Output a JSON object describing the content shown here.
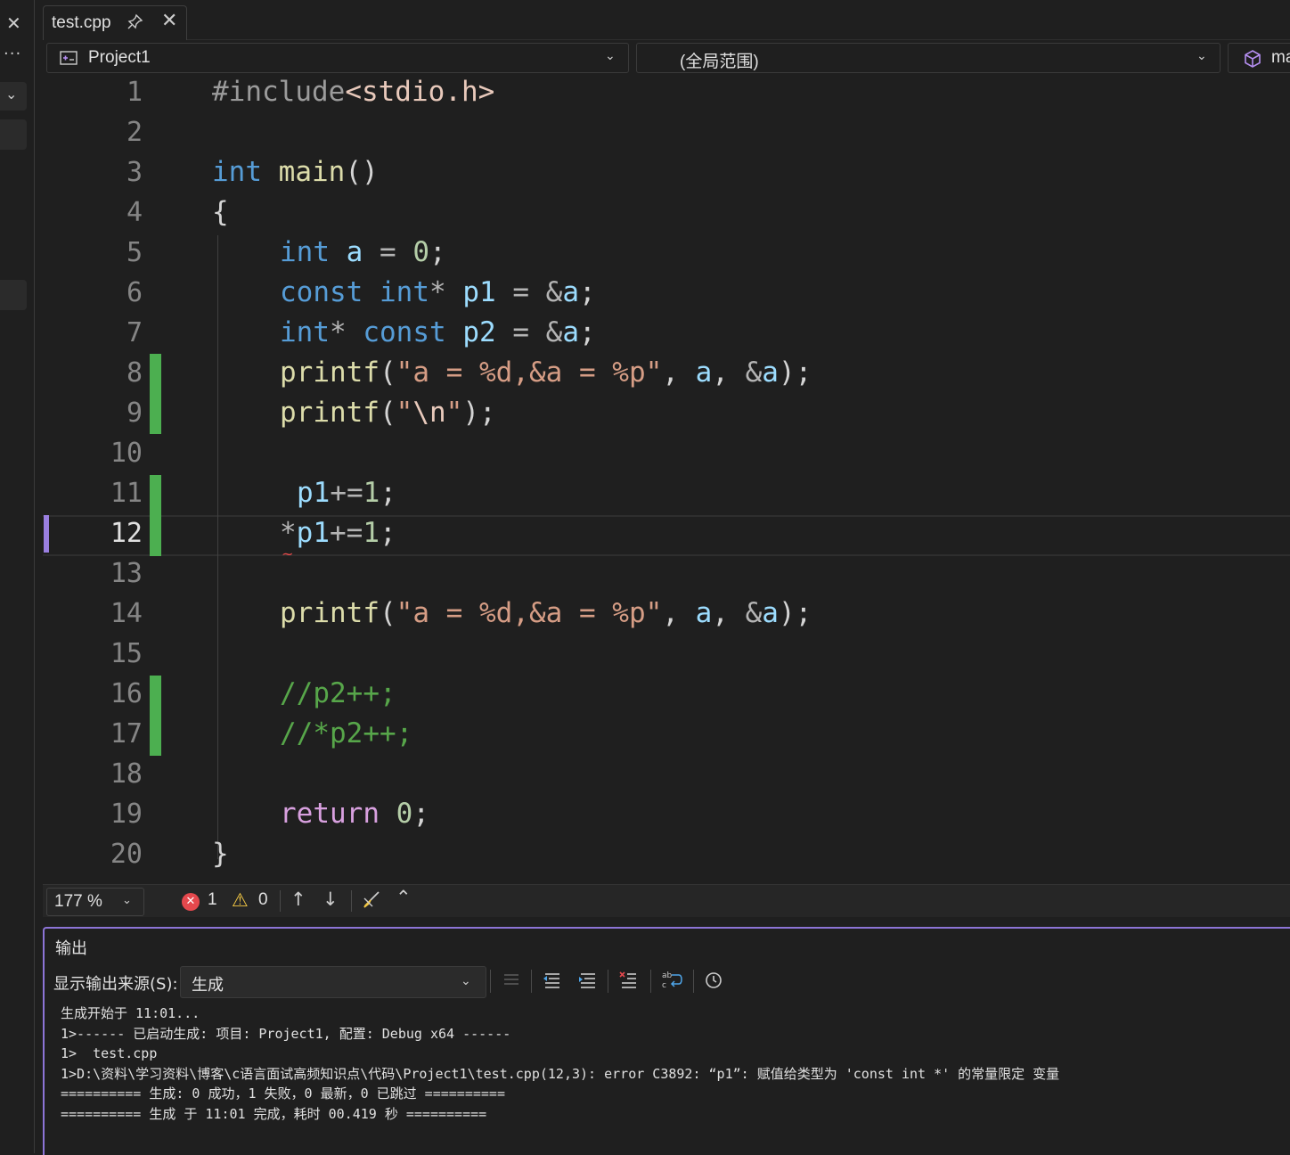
{
  "tab": {
    "filename": "test.cpp"
  },
  "nav": {
    "project": "Project1",
    "scope": "(全局范围)",
    "member": "ma"
  },
  "editor": {
    "line_numbers": [
      "1",
      "2",
      "3",
      "4",
      "5",
      "6",
      "7",
      "8",
      "9",
      "10",
      "11",
      "12",
      "13",
      "14",
      "15",
      "16",
      "17",
      "18",
      "19",
      "20"
    ],
    "current_line": "12",
    "lines": {
      "l1": {
        "pre": "#include",
        "inc": "<stdio.h>"
      },
      "l3": {
        "kw": "int",
        "fn": "main",
        "rest": "()"
      },
      "l4": "{",
      "l5": {
        "kw": "int",
        "var": "a",
        "op": " = ",
        "num": "0",
        "end": ";"
      },
      "l6": {
        "kw1": "const",
        "kw2": "int",
        "star": "*",
        "var": "p1",
        "op": " = ",
        "amp": "&",
        "var2": "a",
        "end": ";"
      },
      "l7": {
        "kw1": "int",
        "star": "*",
        "kw2": "const",
        "var": "p2",
        "op": " = ",
        "amp": "&",
        "var2": "a",
        "end": ";"
      },
      "l8": {
        "fn": "printf",
        "open": "(",
        "str": "\"a = %d,&a = %p\"",
        "sep1": ", ",
        "var": "a",
        "sep2": ", ",
        "amp": "&",
        "var2": "a",
        "end": ");"
      },
      "l9": {
        "fn": "printf",
        "open": "(",
        "q1": "\"",
        "esc": "\\n",
        "q2": "\"",
        "end": ");"
      },
      "l11": {
        "var": "p1",
        "op": "+=",
        "num": "1",
        "end": ";"
      },
      "l12": {
        "star": "*",
        "var": "p1",
        "op": "+=",
        "num": "1",
        "end": ";"
      },
      "l14": {
        "fn": "printf",
        "open": "(",
        "str": "\"a = %d,&a = %p\"",
        "sep1": ", ",
        "var": "a",
        "sep2": ", ",
        "amp": "&",
        "var2": "a",
        "end": ");"
      },
      "l16": "//p2++;",
      "l17": "//*p2++;",
      "l19": {
        "ctl": "return",
        "num": "0",
        "end": ";"
      },
      "l20": "}"
    }
  },
  "statusbar": {
    "zoom": "177 %",
    "errors": "1",
    "warnings": "0"
  },
  "output": {
    "title": "输出",
    "source_label": "显示输出来源(S):",
    "source_value": "生成",
    "lines": [
      "生成开始于 11:01...",
      "1>------ 已启动生成: 项目: Project1, 配置: Debug x64 ------",
      "1>  test.cpp",
      "1>D:\\资料\\学习资料\\博客\\c语言面试高频知识点\\代码\\Project1\\test.cpp(12,3): error C3892: “p1”: 赋值给类型为 'const int *' 的常量限定 变量",
      "========== 生成: 0 成功，1 失败，0 最新，0 已跳过 ==========",
      "========== 生成 于 11:01 完成，耗时 00.419 秒 =========="
    ]
  },
  "colors": {
    "keyword": "#569cd6",
    "control": "#d8a0df",
    "function": "#dcdcaa",
    "variable": "#9cdcfe",
    "number": "#b5cea8",
    "string": "#d69d85",
    "comment": "#57a64a",
    "changed_line": "#4caf50",
    "panel_border": "#8c74d6",
    "error": "#e5484d",
    "warning": "#f2c744"
  }
}
